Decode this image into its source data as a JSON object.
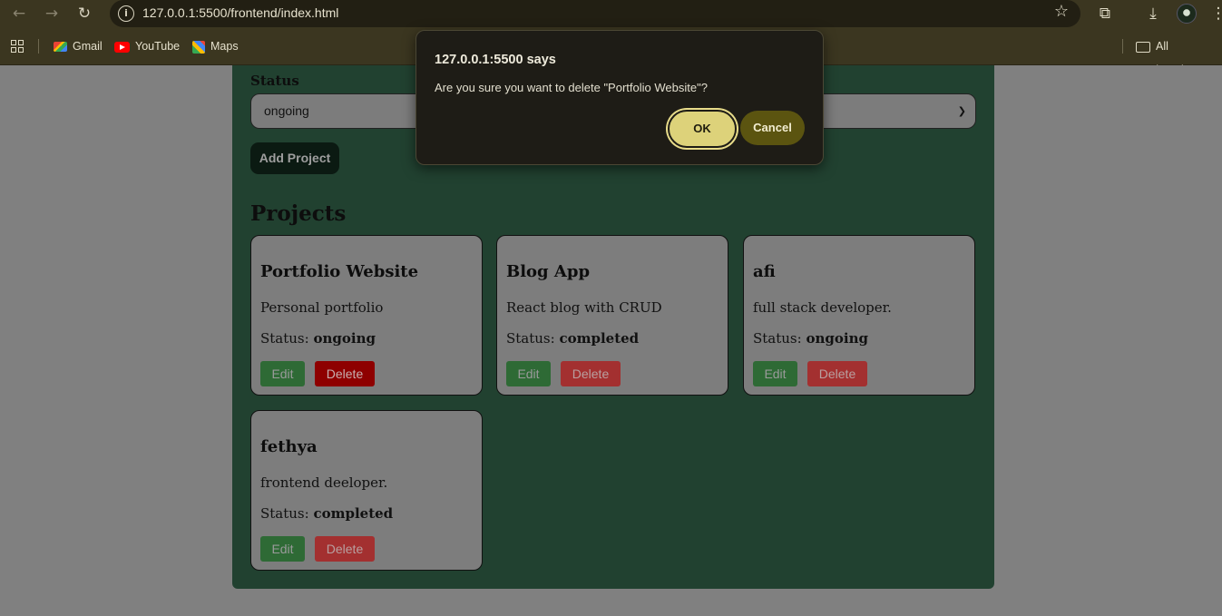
{
  "browser": {
    "url": "127.0.0.1:5500/frontend/index.html",
    "bookmarks": [
      {
        "label": "Gmail",
        "icon": "gmail-icon"
      },
      {
        "label": "YouTube",
        "icon": "youtube-icon"
      },
      {
        "label": "Maps",
        "icon": "maps-icon"
      }
    ],
    "all_bookmarks": "All Bookmarks"
  },
  "form": {
    "status_label": "Status",
    "status_value": "ongoing",
    "add_button": "Add Project"
  },
  "projects": {
    "title": "Projects",
    "status_prefix": "Status:",
    "edit_label": "Edit",
    "delete_label": "Delete",
    "items": [
      {
        "name": "Portfolio Website",
        "description": "Personal portfolio",
        "status": "ongoing"
      },
      {
        "name": "Blog App",
        "description": "React blog with CRUD",
        "status": "completed"
      },
      {
        "name": "afi",
        "description": "full stack developer.",
        "status": "ongoing"
      },
      {
        "name": "fethya",
        "description": "frontend deeloper.",
        "status": "completed"
      }
    ]
  },
  "dialog": {
    "title": "127.0.0.1:5500 says",
    "message": "Are you sure you want to delete \"Portfolio Website\"?",
    "ok_label": "OK",
    "cancel_label": "Cancel"
  },
  "colors": {
    "panel_bg": "#214130",
    "page_bg": "#808080",
    "card_bg": "#7d7d7d",
    "edit_button": "#2e6a35",
    "delete_button": "#a33030",
    "dialog_ok": "#ddd27a",
    "dialog_cancel": "#5b5410"
  }
}
